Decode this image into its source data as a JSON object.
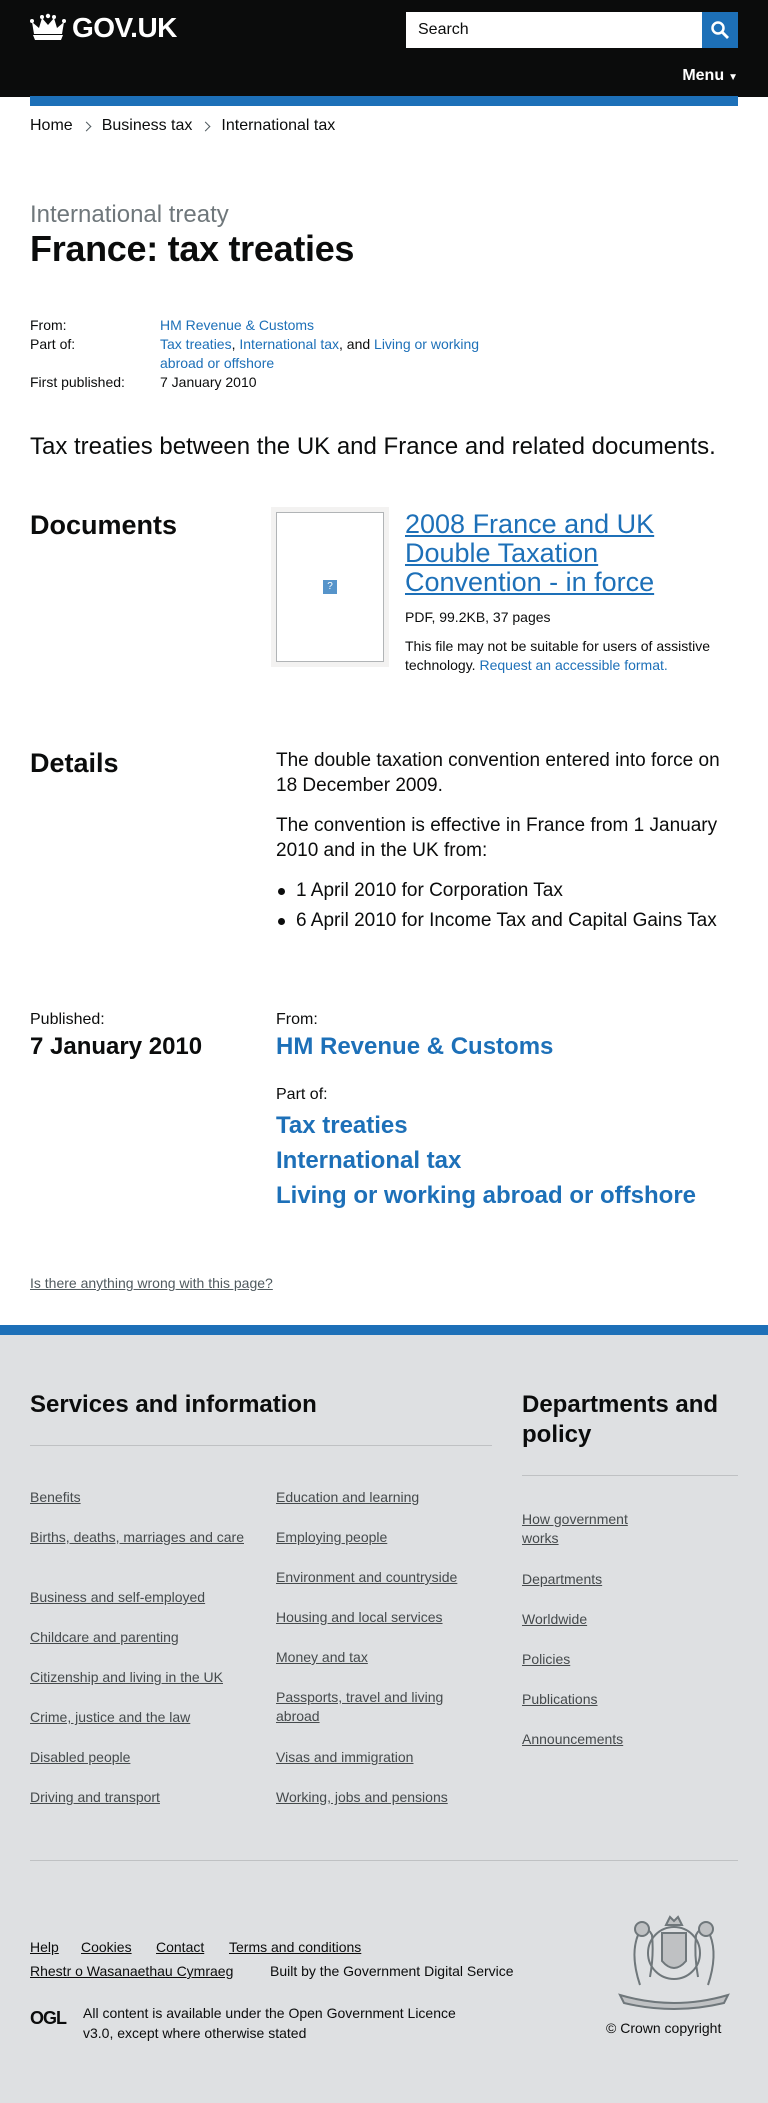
{
  "header": {
    "logo_text": "GOV.UK",
    "search_placeholder": "Search",
    "menu_label": "Menu"
  },
  "breadcrumbs": [
    "Home",
    "Business tax",
    "International tax"
  ],
  "page": {
    "caption": "International treaty",
    "title": "France: tax treaties",
    "meta": {
      "from_label": "From:",
      "from_value": "HM Revenue & Customs",
      "partof_label": "Part of:",
      "partof_link1": "Tax treaties",
      "partof_sep1": ",",
      "partof_link2": "International tax",
      "partof_sep2": ", and",
      "partof_link3": "Living or working abroad or offshore",
      "published_label": "First published:",
      "published_value": "7 January 2010"
    },
    "lede": "Tax treaties between the UK and France and related documents."
  },
  "documents": {
    "heading": "Documents",
    "title": "2008 France and UK Double Taxation Convention - in force",
    "file_meta": "PDF, 99.2KB, 37 pages",
    "note": "This file may not be suitable for users of assistive technology.",
    "note_link": "Request an accessible format."
  },
  "details": {
    "heading": "Details",
    "para1": "The double taxation convention entered into force on 18 December 2009.",
    "para2": "The convention is effective in France from 1 January 2010 and in the UK from:",
    "bullets": [
      "1 April 2010 for Corporation Tax",
      "6 April 2010 for Income Tax and Capital Gains Tax"
    ]
  },
  "metadata_footer": {
    "published_label": "Published:",
    "published_value": "7 January 2010",
    "from_label": "From:",
    "from_value": "HM Revenue & Customs",
    "partof_label": "Part of:",
    "partof": [
      "Tax treaties",
      "International tax",
      "Living or working abroad or offshore"
    ]
  },
  "feedback_link": "Is there anything wrong with this page?",
  "footer": {
    "services_heading": "Services and information",
    "services_col1": [
      "Benefits",
      "Births, deaths, marriages and care",
      "Business and self-employed",
      "Childcare and parenting",
      "Citizenship and living in the UK",
      "Crime, justice and the law",
      "Disabled people",
      "Driving and transport"
    ],
    "services_col2": [
      "Education and learning",
      "Employing people",
      "Environment and countryside",
      "Housing and local services",
      "Money and tax",
      "Passports, travel and living abroad",
      "Visas and immigration",
      "Working, jobs and pensions"
    ],
    "departments_heading": "Departments and policy",
    "departments": [
      "How government works",
      "Departments",
      "Worldwide",
      "Policies",
      "Publications",
      "Announcements"
    ],
    "bottom_links": [
      "Help",
      "Cookies",
      "Contact",
      "Terms and conditions",
      "Rhestr o Wasanaethau Cymraeg"
    ],
    "built_by_prefix": "Built by the",
    "built_by_link": "Government Digital Service",
    "ogl_logo": "OGL",
    "licence_prefix": "All content is available under the",
    "licence_link": "Open Government Licence v3.0",
    "licence_suffix": ", except where otherwise stated",
    "copyright": "© Crown copyright"
  },
  "colors": {
    "brand_blue": "#1d70b8",
    "header_black": "#0b0c0c",
    "footer_grey": "#dee0e2"
  }
}
